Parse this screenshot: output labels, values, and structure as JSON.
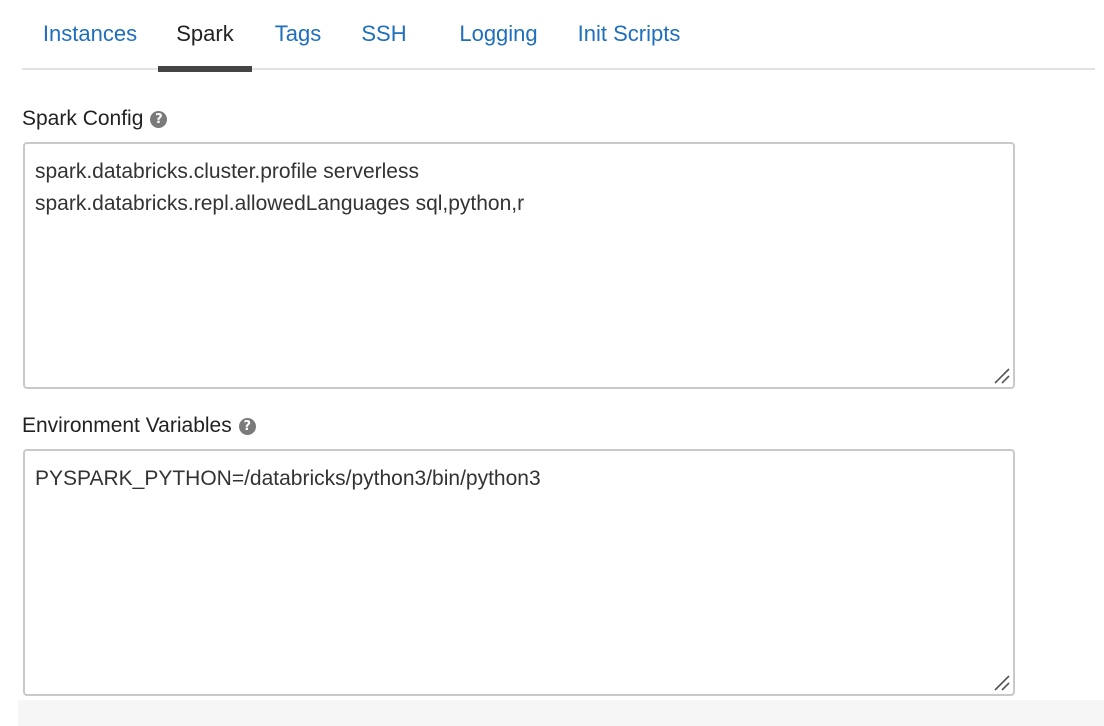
{
  "tabs": [
    {
      "label": "Instances",
      "active": false
    },
    {
      "label": "Spark",
      "active": true
    },
    {
      "label": "Tags",
      "active": false
    },
    {
      "label": "SSH",
      "active": false
    },
    {
      "label": "Logging",
      "active": false
    },
    {
      "label": "Init Scripts",
      "active": false
    }
  ],
  "spark_config": {
    "label": "Spark Config",
    "help_icon": "question-circle-icon",
    "lines": [
      "spark.databricks.cluster.profile serverless",
      "spark.databricks.repl.allowedLanguages sql,python,r"
    ]
  },
  "environment_variables": {
    "label": "Environment Variables",
    "help_icon": "question-circle-icon",
    "lines": [
      "PYSPARK_PYTHON=/databricks/python3/bin/python3"
    ]
  },
  "colors": {
    "link": "#1f6fbd",
    "active_tab_underline": "#444444",
    "border": "#c9c9c9"
  }
}
